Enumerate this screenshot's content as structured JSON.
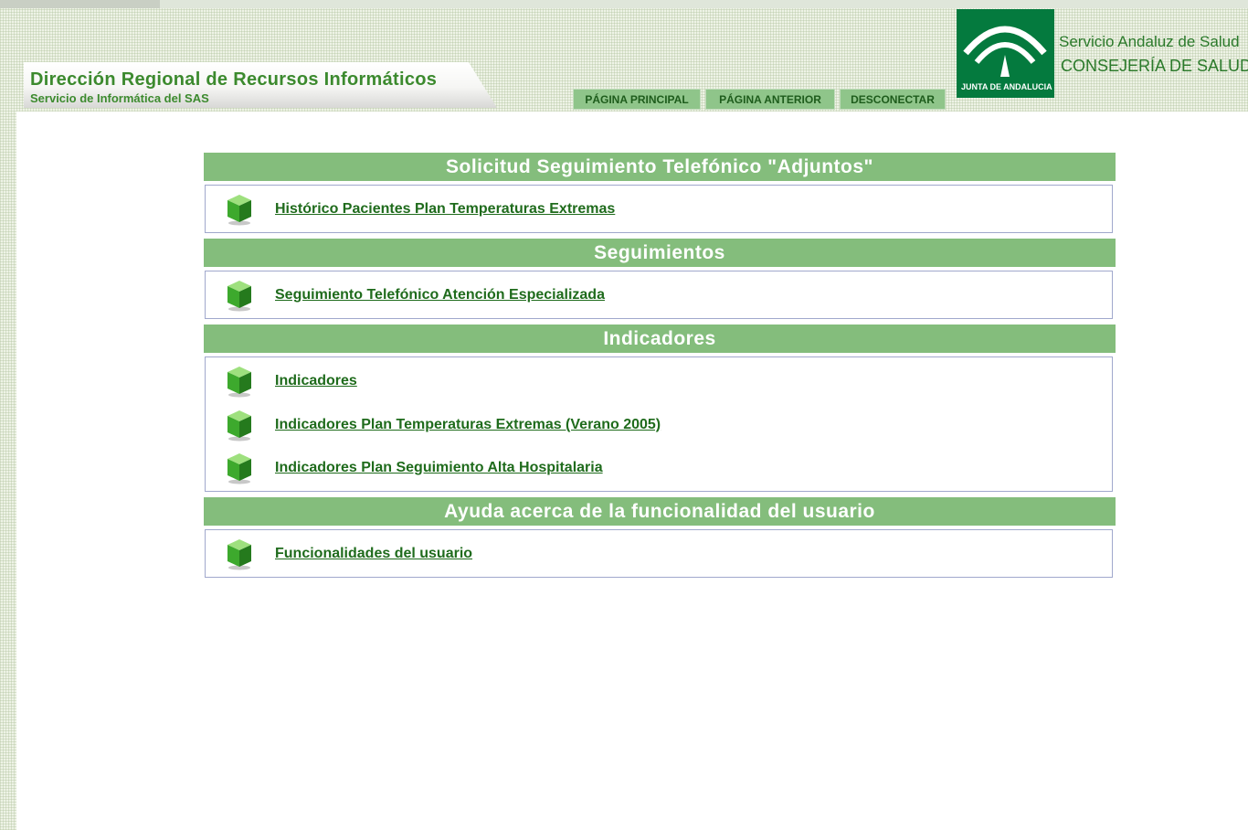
{
  "header": {
    "title": "Dirección Regional de Recursos Informáticos",
    "subtitle": "Servicio de Informática del SAS"
  },
  "nav": {
    "home": "PÁGINA PRINCIPAL",
    "back": "PÁGINA ANTERIOR",
    "logout": "DESCONECTAR"
  },
  "logo": {
    "emblem_text": "JUNTA DE ANDALUCIA",
    "line1": "Servicio Andaluz de Salud",
    "line2": "CONSEJERÍA DE SALUD"
  },
  "sections": [
    {
      "title": "Solicitud Seguimiento Telefónico \"Adjuntos\"",
      "items": [
        {
          "label": "Histórico Pacientes Plan Temperaturas Extremas",
          "icon": "green-cube-icon"
        }
      ]
    },
    {
      "title": "Seguimientos",
      "items": [
        {
          "label": "Seguimiento Telefónico Atención Especializada",
          "icon": "green-cube-icon"
        }
      ]
    },
    {
      "title": "Indicadores",
      "items": [
        {
          "label": "Indicadores",
          "icon": "green-cube-icon"
        },
        {
          "label": "Indicadores Plan Temperaturas Extremas (Verano 2005)",
          "icon": "green-cube-icon"
        },
        {
          "label": "Indicadores Plan Seguimiento Alta Hospitalaria",
          "icon": "green-cube-icon"
        }
      ]
    },
    {
      "title": "Ayuda acerca de la funcionalidad del usuario",
      "items": [
        {
          "label": "Funcionalidades del usuario",
          "icon": "green-cube-icon"
        }
      ]
    }
  ],
  "colors": {
    "section_header_bg": "#84bd7c",
    "link": "#1f6b1c",
    "nav_button_bg": "#8fc58a",
    "logo_bg": "#047a3e"
  }
}
